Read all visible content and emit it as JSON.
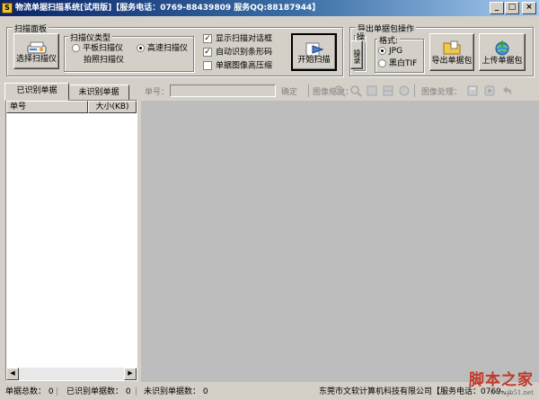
{
  "window": {
    "title": "物流单据扫描系统[试用版]【服务电话：0769-88439809  服务QQ:88187944】",
    "app_icon": "S",
    "min": "_",
    "max": "□",
    "close": "×"
  },
  "scan_panel": {
    "legend": "扫描面板",
    "select_scanner": "选择扫描仪",
    "type_legend": "扫描仪类型",
    "flatbed": "平板扫描仪",
    "highspeed": "高速扫描仪",
    "camera": "拍照扫描仪",
    "selected_type": "高速扫描仪",
    "show_dialog": "显示扫描对话框",
    "auto_barcode": "自动识别条形码",
    "high_compress": "单据图像高压缩",
    "start_scan": "开始扫描"
  },
  "export_panel": {
    "legend": "导出单据包操作",
    "small_legend": "操",
    "format_legend": "格式:",
    "side_button": "操录",
    "jpg": "JPG",
    "bw_tif": "黑白TIF",
    "selected_format": "JPG",
    "export_btn": "导出单据包",
    "upload_btn": "上传单据包"
  },
  "tabs": {
    "recognized": "已识别单据",
    "unrecognized": "未识别单据"
  },
  "list": {
    "columns": [
      "单号",
      "大小(KB)"
    ]
  },
  "toolbar": {
    "doc_no_label": "单号：",
    "confirm": "确定",
    "zoom_label": "图像缩放：",
    "process_label": "图像处理："
  },
  "status": {
    "total": "单据总数：  0",
    "recognized": "已识别单据数：  0",
    "unrecognized": "未识别单据数：  0",
    "company": "东莞市文软计算机科技有限公司【服务电话：0769-...",
    "watermark": "脚本之家",
    "watermark_url": "www.jb51.net"
  }
}
